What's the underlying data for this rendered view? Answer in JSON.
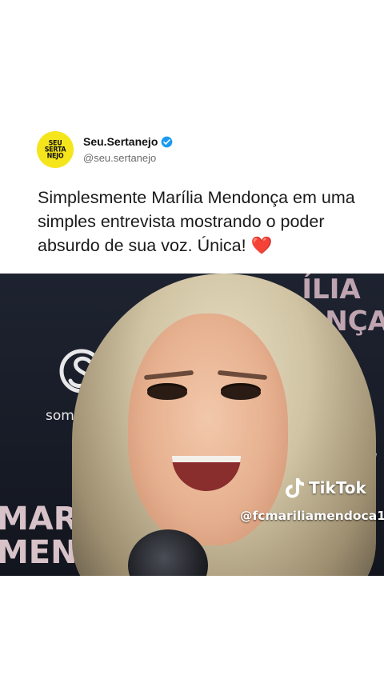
{
  "profile": {
    "avatar_lines": [
      "SEU",
      "SERTA",
      "NEJO"
    ],
    "display_name": "Seu.Sertanejo",
    "handle": "@seu.sertanejo",
    "verified": true,
    "avatar_color": "#f5e51b"
  },
  "post": {
    "text": "Simplesmente Marília Mendonça em uma simples entrevista mostrando o poder absurdo de sua voz. Única!",
    "emoji": "❤️"
  },
  "video": {
    "backdrop_top_right": "ÍLIA\nONÇA",
    "backdrop_left_bottom": "MARÍ\nMEN",
    "backdrop_right_edge": "W",
    "sponsor_text": "som livre",
    "watermark_app": "TikTok",
    "watermark_user": "@fcmariliamendoca1"
  },
  "colors": {
    "verified_blue": "#1d9bf0",
    "heart_red": "#e0243a",
    "handle_gray": "#6b6b6b"
  }
}
